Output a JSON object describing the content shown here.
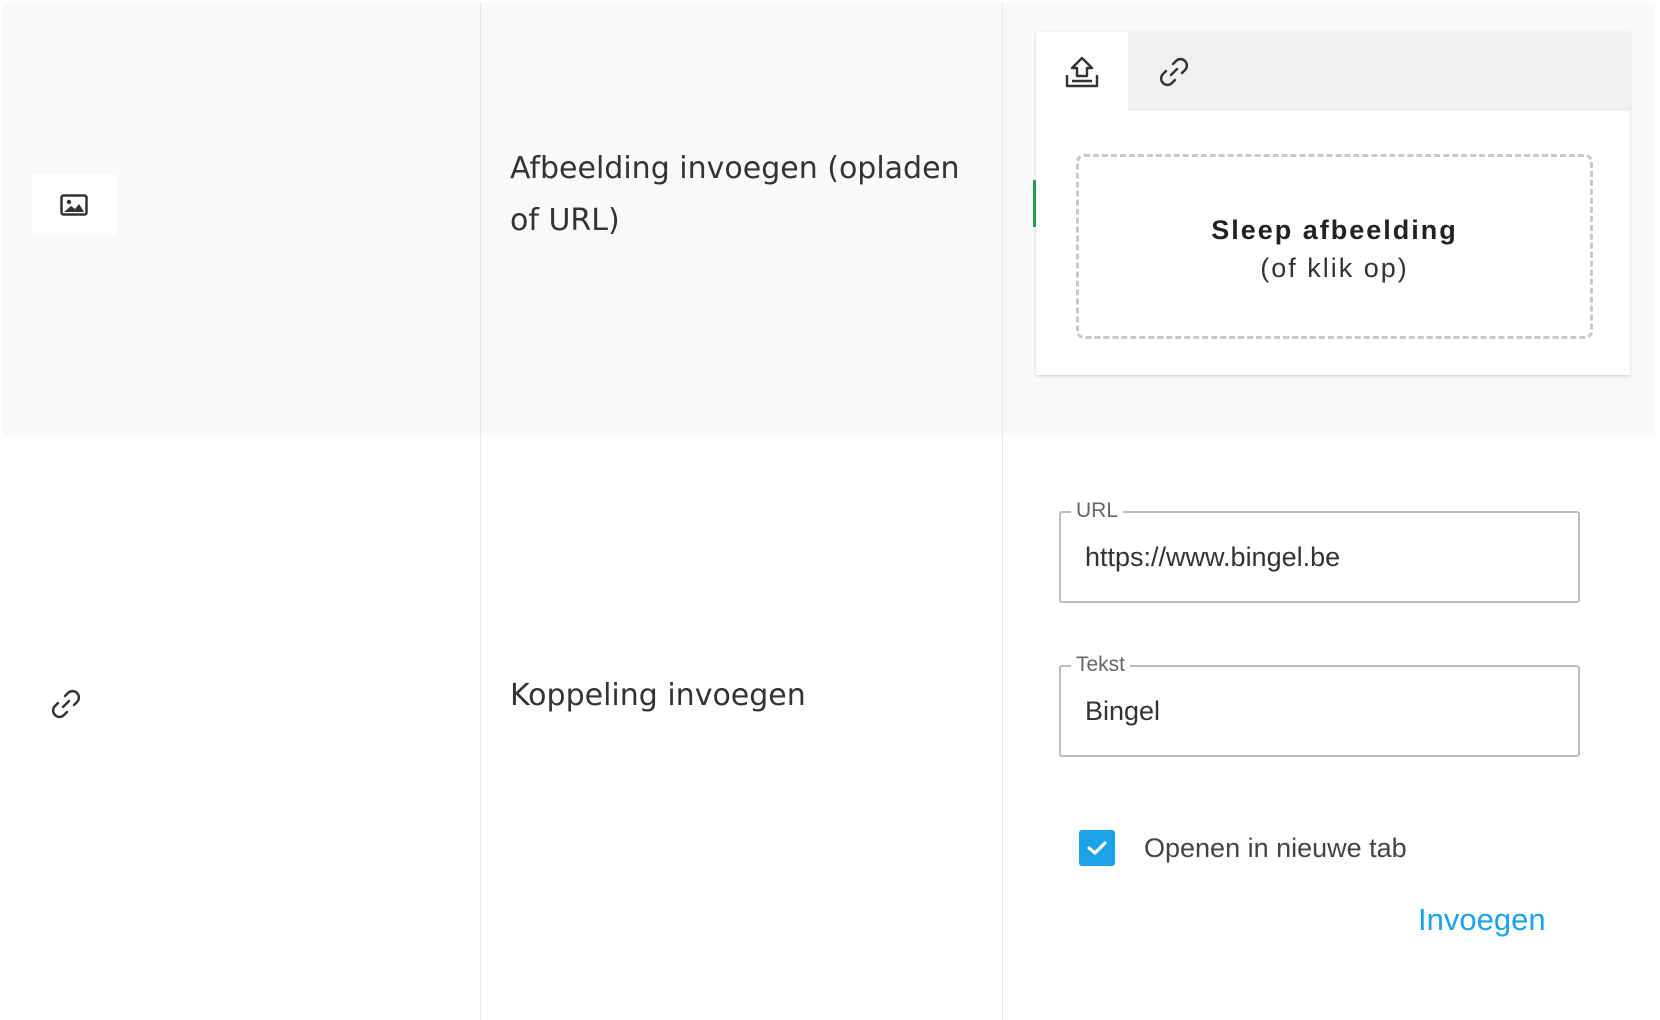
{
  "colors": {
    "accent": "#1aa3e8",
    "row_alt_bg": "#f9f9f9",
    "border": "#e6e6e6"
  },
  "rows": [
    {
      "icon": "image-icon",
      "description": "Afbeelding invoegen (opladen of URL)",
      "upload": {
        "tabs": [
          {
            "icon": "upload-icon",
            "active": true
          },
          {
            "icon": "link-icon",
            "active": false
          }
        ],
        "drop_title": "Sleep afbeelding",
        "drop_subtitle": "(of klik op)"
      }
    },
    {
      "icon": "link-icon",
      "description": "Koppeling invoegen",
      "form": {
        "url_label": "URL",
        "url_value": "https://www.bingel.be",
        "text_label": "Tekst",
        "text_value": "Bingel",
        "new_tab_label": "Openen in nieuwe tab",
        "new_tab_checked": true,
        "insert_label": "Invoegen"
      }
    }
  ]
}
